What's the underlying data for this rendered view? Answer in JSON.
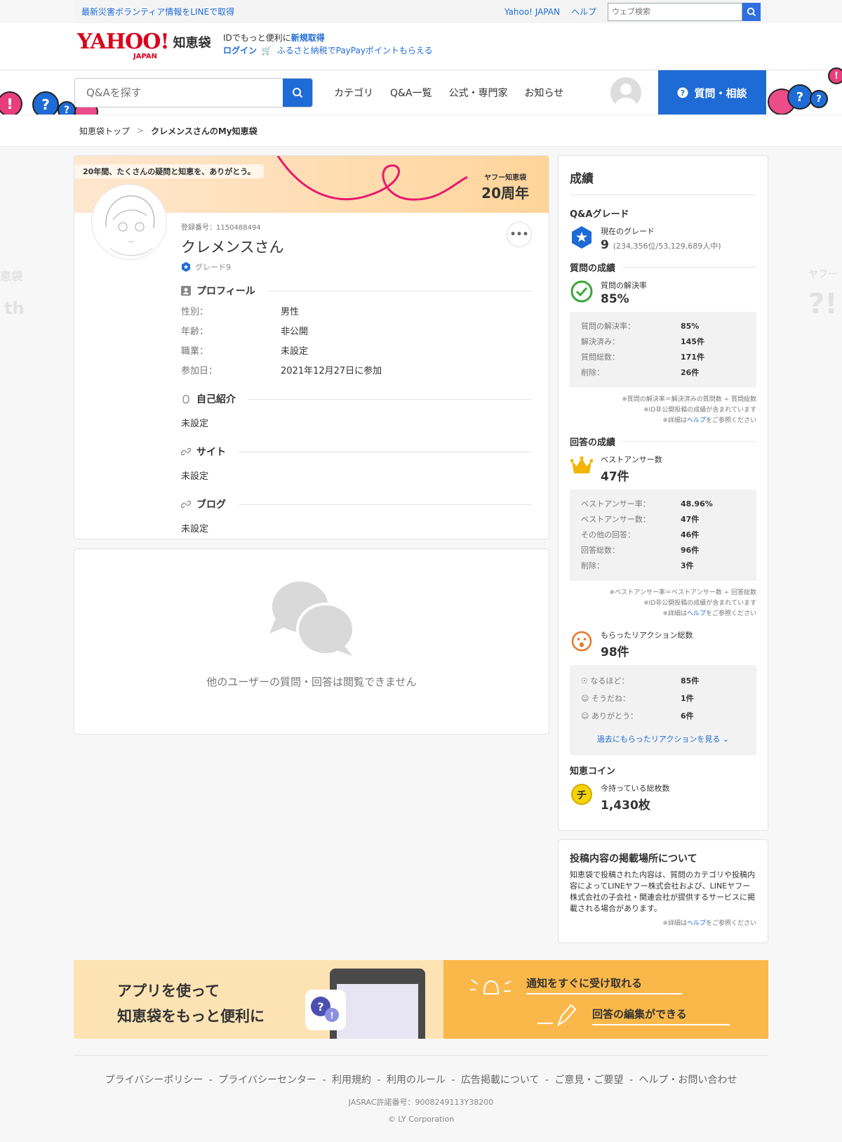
{
  "topbar": {
    "news": "最新災害ボランティア情報をLINEで取得",
    "yahoo_japan": "Yahoo! JAPAN",
    "help": "ヘルプ",
    "web_search_placeholder": "ウェブ検索"
  },
  "header": {
    "logo_text": "YAHOO!",
    "logo_sub": "JAPAN",
    "service_name": "知恵袋",
    "id_prefix": "IDでもっと便利に",
    "id_link": "新規取得",
    "login": "ログイン",
    "furusato": "ふるさと納税でPayPayポイントもらえる"
  },
  "nav": {
    "search_placeholder": "Q&Aを探す",
    "links": [
      "カテゴリ",
      "Q&A一覧",
      "公式・専門家",
      "お知らせ"
    ],
    "ask_button": "質問・相談"
  },
  "breadcrumb": {
    "home": "知恵袋トップ",
    "separator": ">",
    "current": "クレメンスさんのMy知恵袋"
  },
  "profile": {
    "banner_thanks": "20年間、たくさんの疑問と知恵を、ありがとう。",
    "banner_service": "ヤフー知恵袋",
    "banner_years": "20周年",
    "reg_number": "登録番号：1150488494",
    "name": "クレメンスさん",
    "grade": "グレード9",
    "more": "•••",
    "section_profile": "プロフィール",
    "fields": [
      {
        "key": "性別：",
        "value": "男性"
      },
      {
        "key": "年齢：",
        "value": "非公開"
      },
      {
        "key": "職業：",
        "value": "未設定"
      },
      {
        "key": "参加日：",
        "value": "2021年12月27日に参加"
      }
    ],
    "section_intro": "自己紹介",
    "intro_value": "未設定",
    "section_site": "サイト",
    "site_value": "未設定",
    "section_blog": "ブログ",
    "blog_value": "未設定"
  },
  "empty_card": {
    "message": "他のユーザーの質問・回答は閲覧できません"
  },
  "stats": {
    "title": "成績",
    "qa_grade_head": "Q&Aグレード",
    "current_grade_label": "現在のグレード",
    "current_grade_value": "9",
    "current_grade_rank": "(234,356位/53,129,689人中)",
    "question_head": "質問の成績",
    "resolve_rate_label": "質問の解決率",
    "resolve_rate_value": "85%",
    "question_rows": [
      {
        "key": "質問の解決率：",
        "value": "85%"
      },
      {
        "key": "解決済み：",
        "value": "145件"
      },
      {
        "key": "質問総数：",
        "value": "171件"
      },
      {
        "key": "削除：",
        "value": "26件"
      }
    ],
    "question_notes": [
      "※質問の解決率＝解決済みの質問数 ÷ 質問総数",
      "※ID非公開投稿の成績が含まれています"
    ],
    "help_note_prefix": "※詳細は",
    "help_note_link": "ヘルプ",
    "help_note_suffix": "をご参照ください",
    "answer_head": "回答の成績",
    "best_answer_label": "ベストアンサー数",
    "best_answer_value": "47件",
    "answer_rows": [
      {
        "key": "ベストアンサー率：",
        "value": "48.96%"
      },
      {
        "key": "ベストアンサー数：",
        "value": "47件"
      },
      {
        "key": "その他の回答：",
        "value": "46件"
      },
      {
        "key": "回答総数：",
        "value": "96件"
      },
      {
        "key": "削除：",
        "value": "3件"
      }
    ],
    "answer_notes": [
      "※ベストアンサー率＝ベストアンサー数 ÷ 回答総数",
      "※ID非公開投稿の成績が含まれています"
    ],
    "reaction_label": "もらったリアクション総数",
    "reaction_value": "98件",
    "reaction_rows": [
      {
        "key": "なるほど：",
        "value": "85件"
      },
      {
        "key": "そうだね：",
        "value": "1件"
      },
      {
        "key": "ありがとう：",
        "value": "6件"
      }
    ],
    "reaction_link": "過去にもらったリアクションを見る",
    "coin_head": "知恵コイン",
    "coin_label": "今持っている総枚数",
    "coin_value": "1,430枚",
    "coin_glyph": "チ"
  },
  "placement": {
    "title": "投稿内容の掲載場所について",
    "body": "知恵袋で投稿された内容は、質問のカテゴリや投稿内容によってLINEヤフー株式会社および、LINEヤフー株式会社の子会社・関連会社が提供するサービスに掲載される場合があります。"
  },
  "app_banner": {
    "line1": "アプリを使って",
    "line2": "知恵袋をもっと便利に",
    "feature1": "通知をすぐに受け取れる",
    "feature2": "回答の編集ができる"
  },
  "footer": {
    "links": [
      "プライバシーポリシー",
      "プライバシーセンター",
      "利用規約",
      "利用のルール",
      "広告掲載について",
      "ご意見・ご要望",
      "ヘルプ・お問い合わせ"
    ],
    "jasrac": "JASRAC許諾番号：9008249113Y38200",
    "copyright": "© LY Corporation"
  },
  "colors": {
    "brand_red": "#d8001b",
    "accent_blue": "#1e6bd6",
    "banner_orange": "#fbb84a"
  }
}
